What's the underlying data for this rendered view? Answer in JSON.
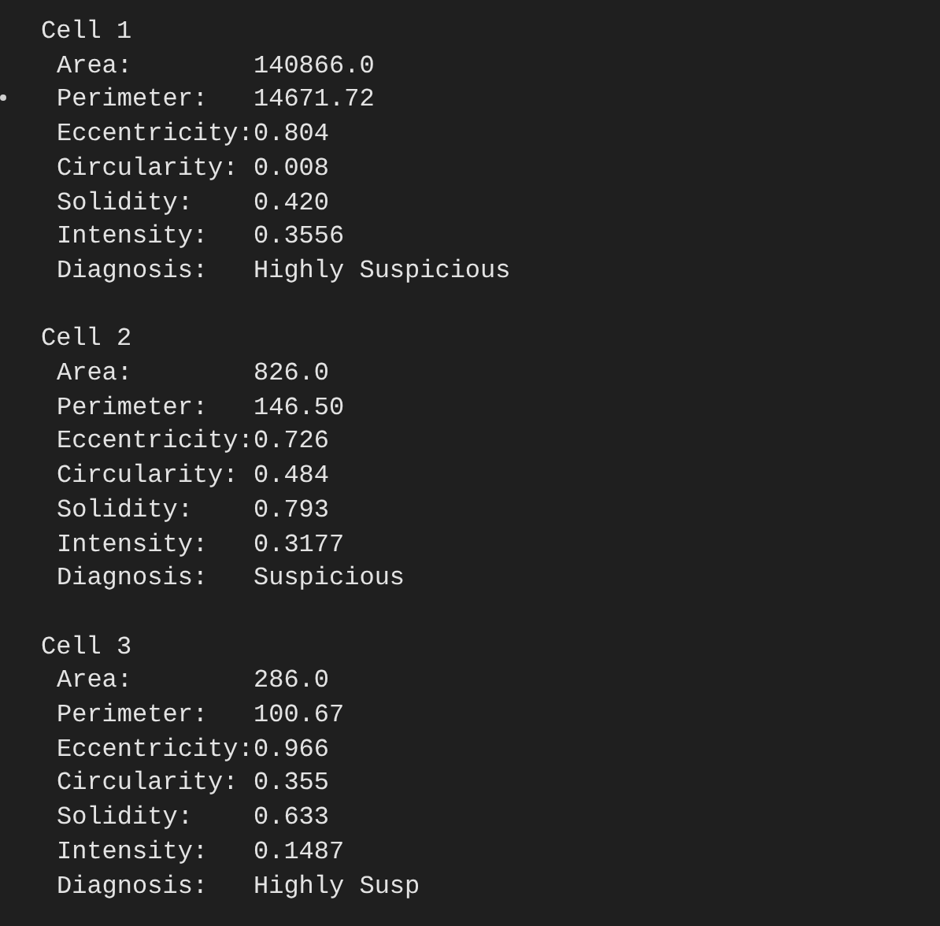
{
  "cells": [
    {
      "title": "Cell 1",
      "fields": [
        {
          "label": "Area:",
          "value": "140866.0"
        },
        {
          "label": "Perimeter:",
          "value": "14671.72"
        },
        {
          "label": "Eccentricity:",
          "value": "0.804"
        },
        {
          "label": "Circularity:",
          "value": "0.008"
        },
        {
          "label": "Solidity:",
          "value": "0.420"
        },
        {
          "label": "Intensity:",
          "value": "0.3556"
        },
        {
          "label": "Diagnosis:",
          "value": "Highly Suspicious"
        }
      ]
    },
    {
      "title": "Cell 2",
      "fields": [
        {
          "label": "Area:",
          "value": "826.0"
        },
        {
          "label": "Perimeter:",
          "value": "146.50"
        },
        {
          "label": "Eccentricity:",
          "value": "0.726"
        },
        {
          "label": "Circularity:",
          "value": "0.484"
        },
        {
          "label": "Solidity:",
          "value": "0.793"
        },
        {
          "label": "Intensity:",
          "value": "0.3177"
        },
        {
          "label": "Diagnosis:",
          "value": "Suspicious"
        }
      ]
    },
    {
      "title": "Cell 3",
      "fields": [
        {
          "label": "Area:",
          "value": "286.0"
        },
        {
          "label": "Perimeter:",
          "value": "100.67"
        },
        {
          "label": "Eccentricity:",
          "value": "0.966"
        },
        {
          "label": "Circularity:",
          "value": "0.355"
        },
        {
          "label": "Solidity:",
          "value": "0.633"
        },
        {
          "label": "Intensity:",
          "value": "0.1487"
        },
        {
          "label": "Diagnosis:",
          "value": "Highly Susp"
        }
      ]
    }
  ]
}
